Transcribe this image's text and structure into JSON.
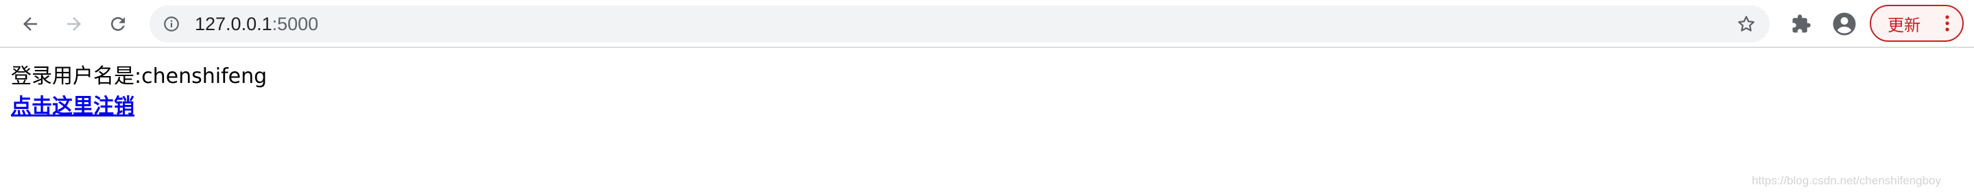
{
  "browser": {
    "address_bar": {
      "host": "127.0.0.1",
      "port": ":5000"
    },
    "update_button_label": "更新",
    "colors": {
      "update_accent": "#c5221f",
      "omnibox_bg": "#f1f3f4",
      "link": "#0000ee"
    },
    "icons": [
      "back-arrow-icon",
      "forward-arrow-icon",
      "reload-icon",
      "info-icon",
      "star-icon",
      "puzzle-extensions-icon",
      "profile-avatar-icon",
      "vertical-dots-menu-icon"
    ]
  },
  "page": {
    "login_text": "登录用户名是:chenshifeng",
    "logout_link": "点击这里注销"
  },
  "watermark": "https://blog.csdn.net/chenshifengboy"
}
